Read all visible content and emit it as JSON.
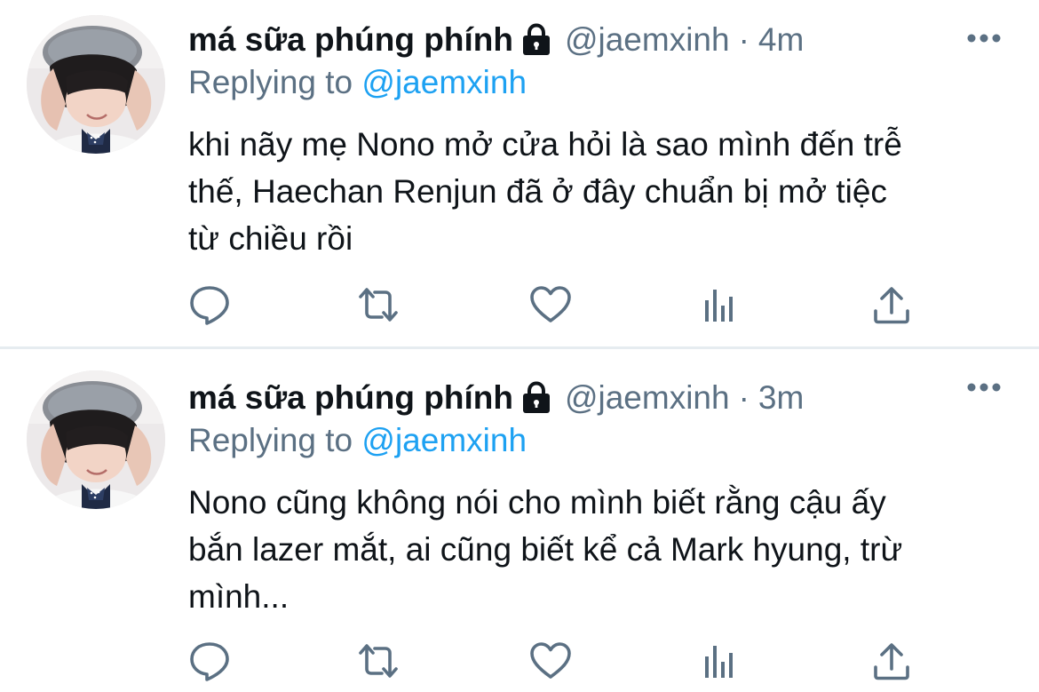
{
  "tweets": [
    {
      "display_name": "má sữa phúng phính",
      "handle": "@jaemxinh",
      "separator": "·",
      "time": "4m",
      "replying_prefix": "Replying to",
      "replying_handle": "@jaemxinh",
      "text_lines": [
        "khi nãy mẹ Nono mở cửa hỏi là sao mình đến trễ",
        "thế, Haechan Renjun đã ở đây chuẩn bị mở tiệc",
        "từ chiều rồi"
      ],
      "icons": {
        "lock": "lock-icon",
        "more": "more-icon",
        "reply": "reply-icon",
        "retweet": "retweet-icon",
        "like": "heart-icon",
        "analytics": "analytics-icon",
        "share": "share-icon"
      }
    },
    {
      "display_name": "má sữa phúng phính",
      "handle": "@jaemxinh",
      "separator": "·",
      "time": "3m",
      "replying_prefix": "Replying to",
      "replying_handle": "@jaemxinh",
      "text_lines": [
        "Nono cũng không nói cho mình biết rằng cậu ấy",
        "bắn lazer mắt, ai cũng biết kể cả Mark hyung, trừ",
        "mình..."
      ],
      "icons": {
        "lock": "lock-icon",
        "more": "more-icon",
        "reply": "reply-icon",
        "retweet": "retweet-icon",
        "like": "heart-icon",
        "analytics": "analytics-icon",
        "share": "share-icon"
      }
    }
  ],
  "colors": {
    "primary_text": "#0f1419",
    "secondary_text": "#5b7083",
    "link": "#1da1f2",
    "icon": "#5b7083",
    "divider": "#e6ecf0",
    "background": "#ffffff"
  }
}
